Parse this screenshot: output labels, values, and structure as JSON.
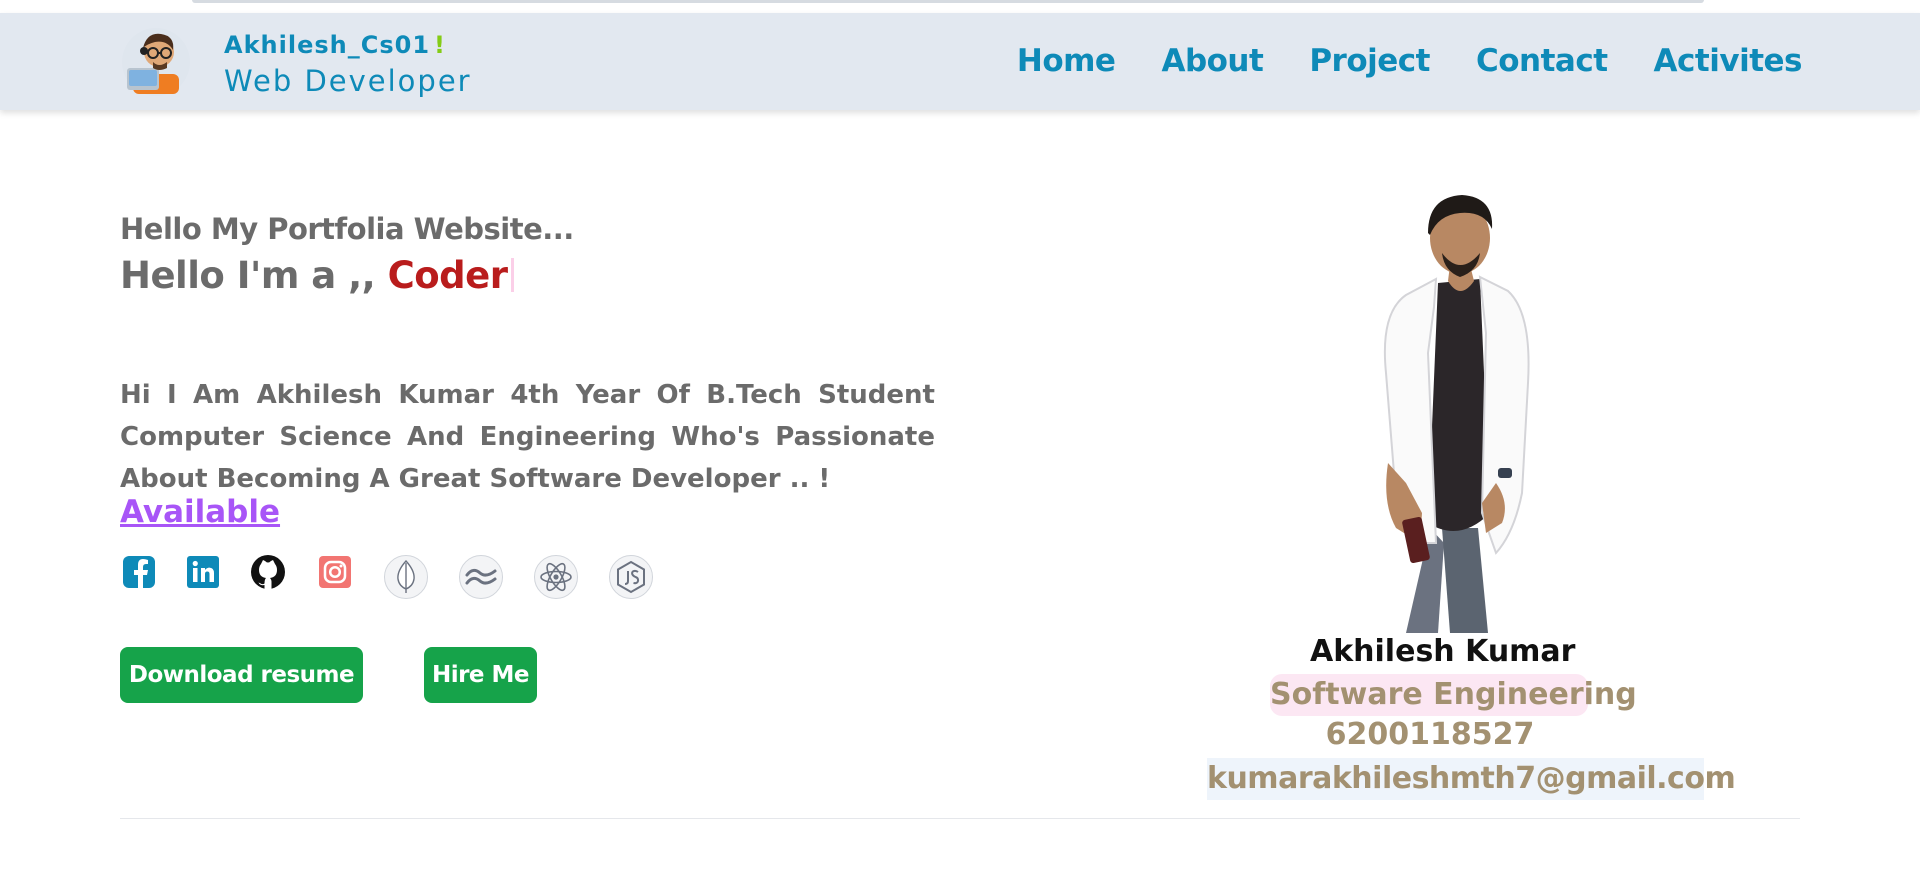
{
  "brand": {
    "name": "Akhilesh_Cs01",
    "exclaim": "!",
    "role": "Web Developer",
    "avatar": "avatar-illustration"
  },
  "nav": {
    "items": [
      "Home",
      "About",
      "Project",
      "Contact",
      "Activites"
    ]
  },
  "hero": {
    "greeting": "Hello My Portfolia Website...",
    "headline_prefix": "Hello I'm a ,, ",
    "headline_word": "Coder",
    "bio": "Hi I Am Akhilesh Kumar 4th Year Of B.Tech Student Computer Science And Engineering Who's Passionate About Becoming A Great Software Developer .. !",
    "status_link": "Available",
    "social_icons": [
      "facebook-icon",
      "linkedin-icon",
      "github-icon",
      "instagram-icon"
    ],
    "tech_icons": [
      "mongodb-icon",
      "tailwind-icon",
      "react-icon",
      "nodejs-icon"
    ]
  },
  "buttons": {
    "resume": "Download resume",
    "hire": "Hire Me"
  },
  "profile": {
    "name": "Akhilesh Kumar",
    "role": "Software Engineering",
    "phone": "6200118527",
    "email": "kumarakhileshmth7@gmail.com"
  },
  "colors": {
    "nav_bg": "#e2e8f0",
    "brand_blue": "#0e8ab8",
    "accent_red": "#b91c1c",
    "available_purple": "#a855f7",
    "button_green": "#16a34a",
    "profile_text": "#a39171"
  }
}
